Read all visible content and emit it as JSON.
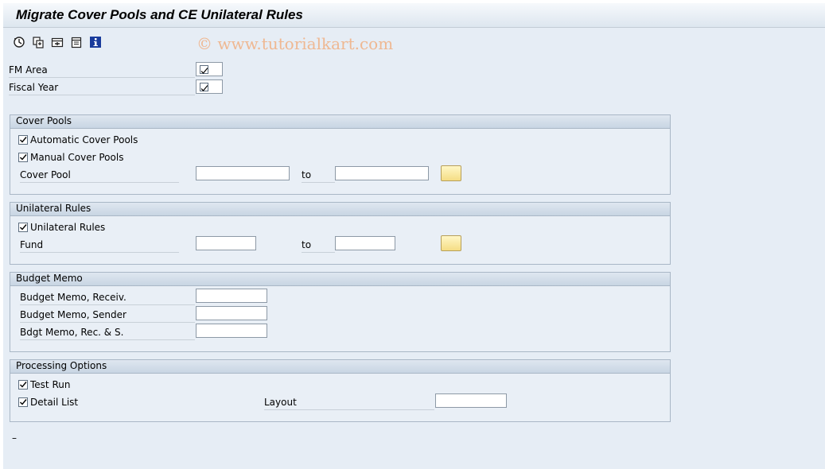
{
  "title": "Migrate Cover Pools and CE Unilateral Rules",
  "watermark": "© www.tutorialkart.com",
  "toolbar": {
    "icons": [
      "execute-icon",
      "copy-icon",
      "variant-icon",
      "document-icon",
      "info-icon"
    ]
  },
  "top_fields": {
    "fm_area": "FM Area",
    "fiscal_year": "Fiscal Year"
  },
  "cover_pools": {
    "header": "Cover Pools",
    "automatic": "Automatic Cover Pools",
    "manual": "Manual Cover Pools",
    "cover_pool": "Cover Pool",
    "to": "to",
    "cover_pool_from": "",
    "cover_pool_to": ""
  },
  "unilateral_rules": {
    "header": "Unilateral Rules",
    "unilateral": "Unilateral Rules",
    "fund": "Fund",
    "to": "to",
    "fund_from": "",
    "fund_to": ""
  },
  "budget_memo": {
    "header": "Budget Memo",
    "receiv": "Budget Memo, Receiv.",
    "sender": "Budget Memo, Sender",
    "rec_s": "Bdgt Memo, Rec. & S."
  },
  "processing_options": {
    "header": "Processing Options",
    "test_run": "Test Run",
    "detail_list": "Detail List",
    "layout": "Layout",
    "layout_value": ""
  },
  "status": "–",
  "colors": {
    "background": "#e6edf5",
    "group_header": "#c8d5e3",
    "select_button": "#f5dd84"
  }
}
